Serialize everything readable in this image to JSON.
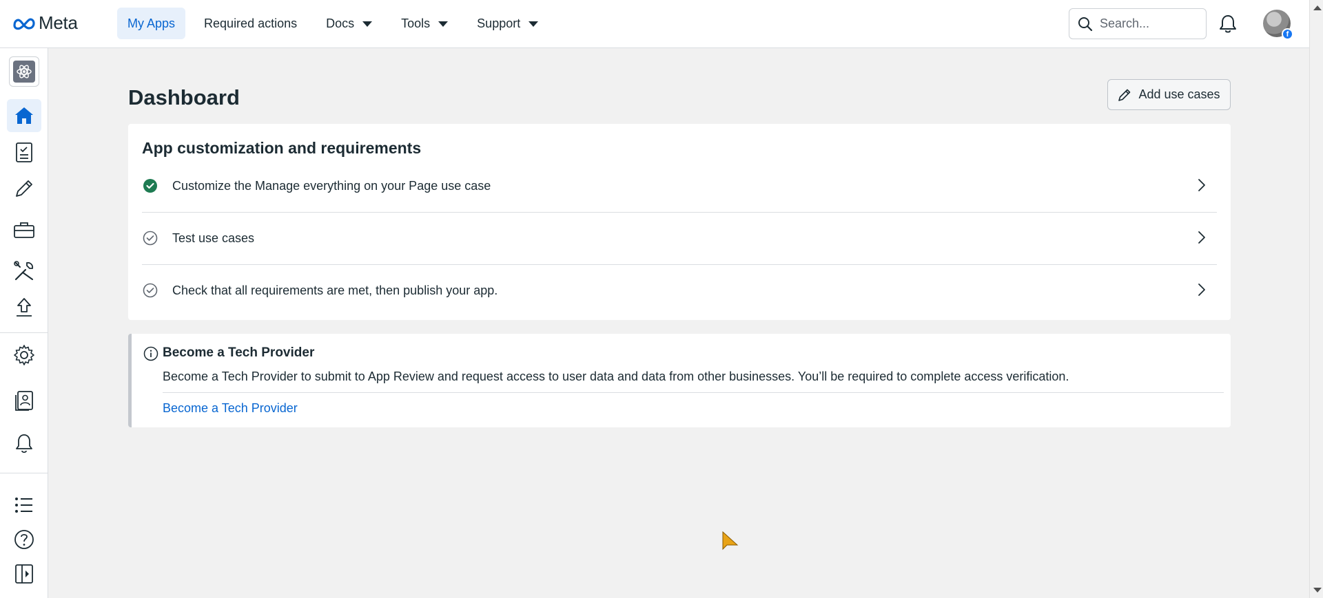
{
  "brand": {
    "name": "Meta"
  },
  "nav": {
    "items": [
      {
        "label": "My Apps",
        "active": true,
        "has_dropdown": false
      },
      {
        "label": "Required actions",
        "active": false,
        "has_dropdown": false
      },
      {
        "label": "Docs",
        "active": false,
        "has_dropdown": true
      },
      {
        "label": "Tools",
        "active": false,
        "has_dropdown": true
      },
      {
        "label": "Support",
        "active": false,
        "has_dropdown": true
      }
    ]
  },
  "search": {
    "placeholder": "Search...",
    "value": ""
  },
  "sidebar": {
    "items": [
      {
        "icon": "app-icon"
      },
      {
        "icon": "home-icon",
        "active": true
      },
      {
        "icon": "checklist-icon"
      },
      {
        "icon": "pencil-icon"
      },
      {
        "icon": "briefcase-icon"
      },
      {
        "icon": "tools-icon"
      },
      {
        "icon": "upload-icon"
      },
      {
        "icon": "gear-icon"
      },
      {
        "icon": "contacts-icon"
      },
      {
        "icon": "bell-icon"
      },
      {
        "icon": "list-icon"
      },
      {
        "icon": "help-icon"
      },
      {
        "icon": "collapse-panel-icon"
      }
    ]
  },
  "main": {
    "title": "Dashboard",
    "add_button_label": "Add use cases",
    "card": {
      "title": "App customization and requirements",
      "tasks": [
        {
          "label": "Customize the Manage everything on your Page use case",
          "status": "complete"
        },
        {
          "label": "Test use cases",
          "status": "pending"
        },
        {
          "label": "Check that all requirements are met, then publish your app.",
          "status": "pending"
        }
      ]
    },
    "notice": {
      "title": "Become a Tech Provider",
      "body": "Become a Tech Provider to submit to App Review and request access to user data and data from other businesses. You’ll be required to complete access verification.",
      "link": "Become a Tech Provider"
    }
  },
  "colors": {
    "accent": "#0866d1",
    "complete": "#1e7b52",
    "active_bg": "#e7f0fb"
  }
}
